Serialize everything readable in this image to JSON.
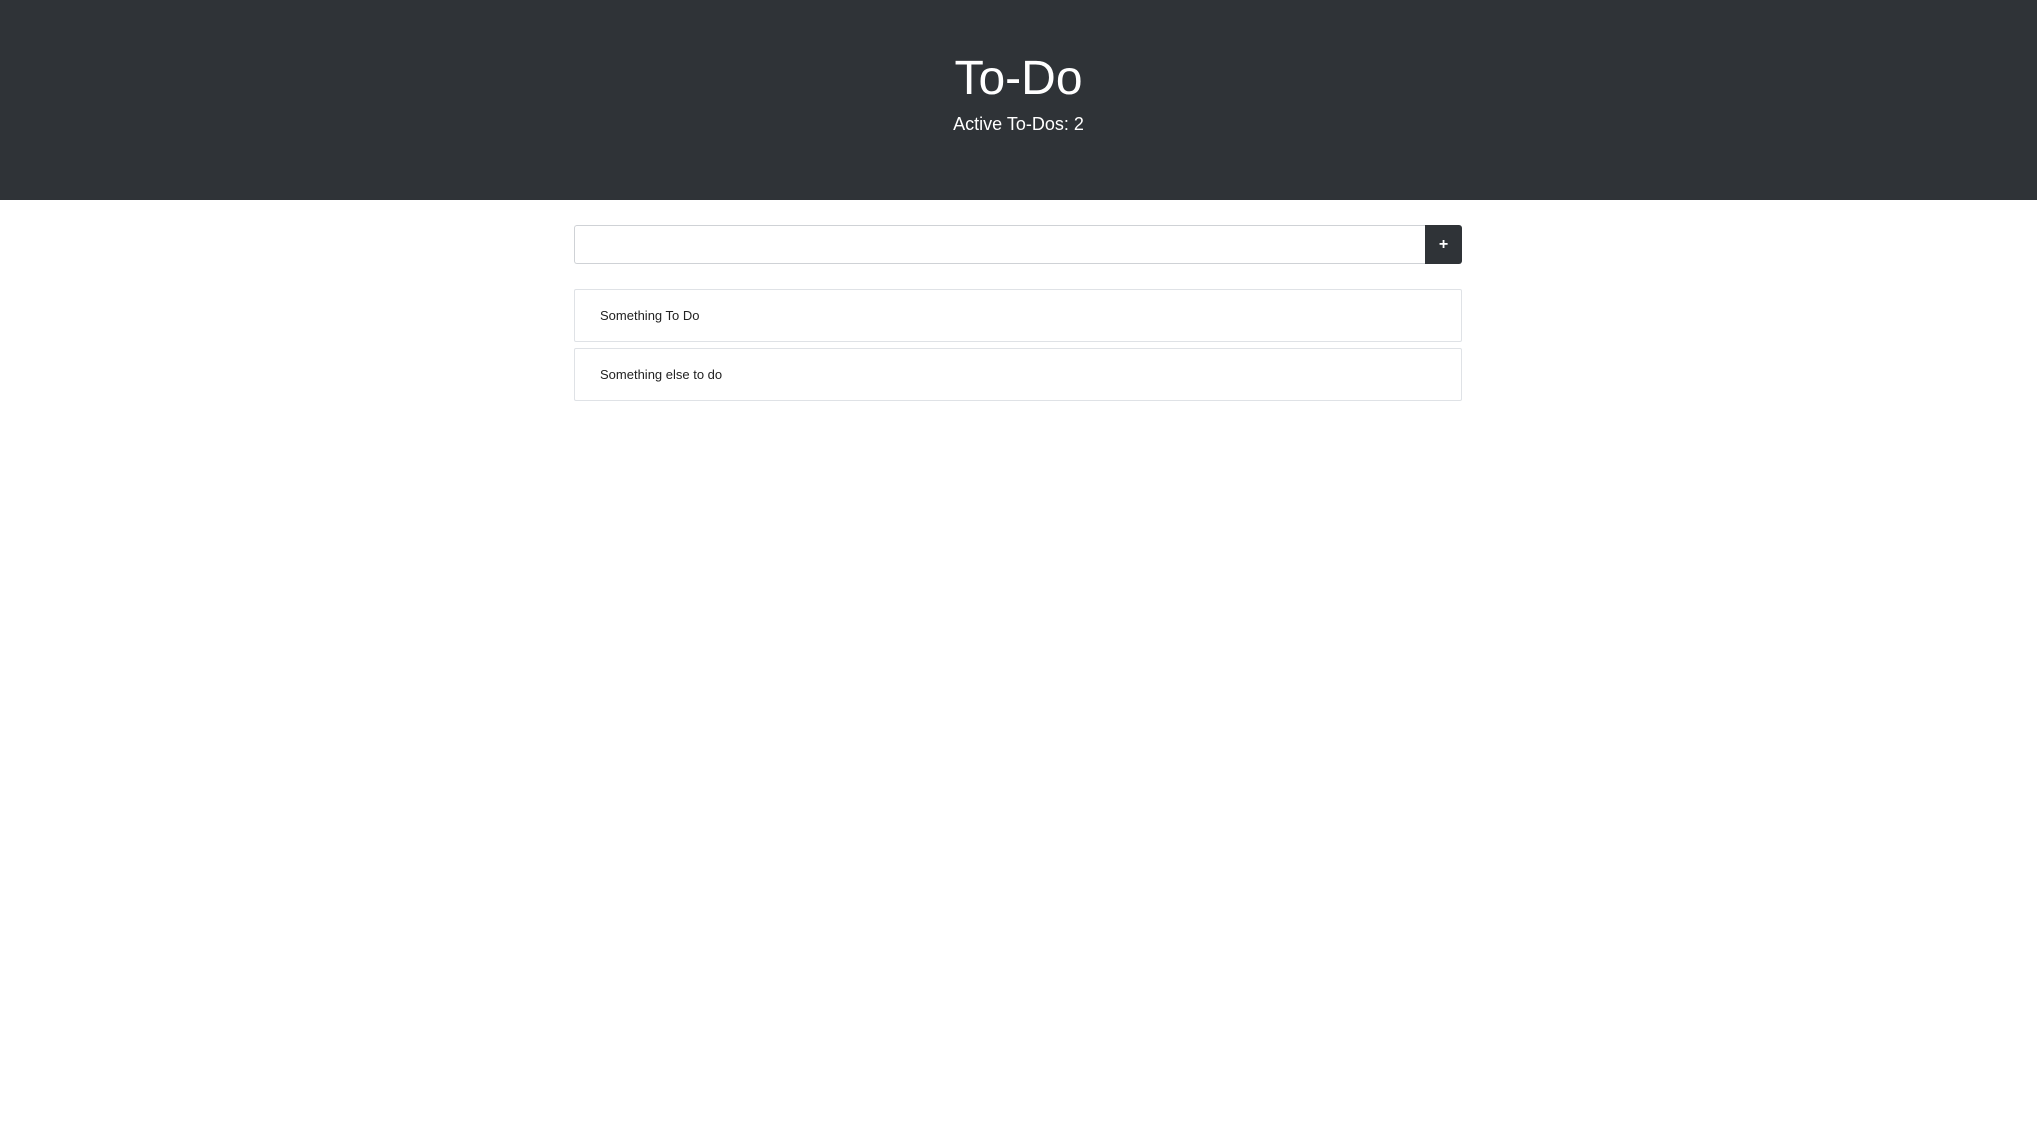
{
  "header": {
    "title": "To-Do",
    "active_count_text": "Active To-Dos: 2",
    "background_color": "#2f3337"
  },
  "add_form": {
    "input_value": "",
    "input_placeholder": "",
    "add_button_label": "+",
    "add_button_icon": "plus-icon"
  },
  "todos": [
    {
      "text": "Something To Do"
    },
    {
      "text": "Something else to do"
    }
  ]
}
